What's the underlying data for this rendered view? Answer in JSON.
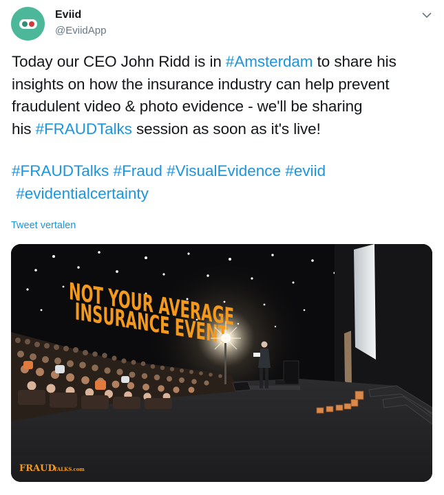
{
  "tweet": {
    "display_name": "Eviid",
    "handle": "@EviidApp",
    "text_lines": [
      {
        "before": "Today our CEO John Ridd is in ",
        "tag": "#Amsterdam",
        "after": " to share his"
      },
      {
        "before": "insights on how the insurance industry can help prevent",
        "tag": "",
        "after": ""
      },
      {
        "before": "fraudulent video & photo evidence - we'll be sharing",
        "tag": "",
        "after": ""
      },
      {
        "before": "his ",
        "tag": "#FRAUDTalks",
        "after": " session as soon as it's live!"
      }
    ],
    "hashtags_line1": [
      "#FRAUDTalks",
      "#Fraud",
      "#VisualEvidence",
      "#eviid"
    ],
    "hashtags_line2": [
      "#evidentialcertainty"
    ],
    "translate_label": "Tweet vertalen"
  },
  "media": {
    "backdrop_line1": "NOT YOUR AVERAGE",
    "backdrop_line2": "INSURANCE EVENT",
    "brand_main": "FRAUD",
    "brand_suffix": "TALKS.com"
  },
  "colors": {
    "link": "#1b95e0",
    "avatar_bg": "#4db899",
    "slogan": "#f39a1e"
  }
}
